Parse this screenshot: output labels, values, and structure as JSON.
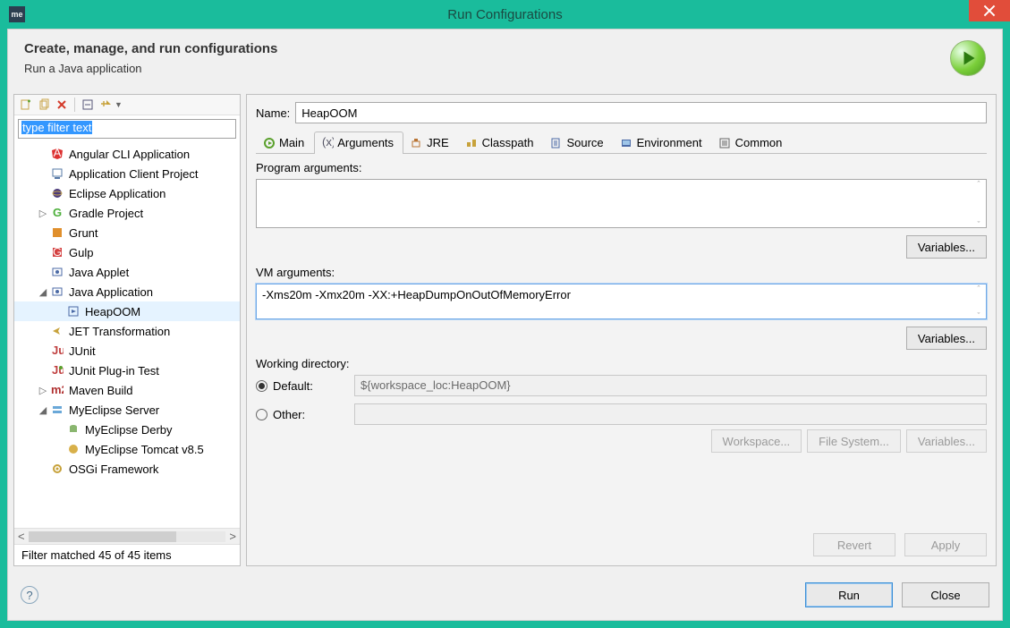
{
  "window": {
    "title": "Run Configurations",
    "close": "×"
  },
  "header": {
    "title": "Create, manage, and run configurations",
    "subtitle": "Run a Java application"
  },
  "filter": {
    "placeholder": "type filter text"
  },
  "tree": [
    {
      "label": "Angular CLI Application",
      "indent": 1,
      "expander": "",
      "icon": "angular"
    },
    {
      "label": "Application Client Project",
      "indent": 1,
      "expander": "",
      "icon": "appclient"
    },
    {
      "label": "Eclipse Application",
      "indent": 1,
      "expander": "",
      "icon": "eclipse"
    },
    {
      "label": "Gradle Project",
      "indent": 1,
      "expander": "▷",
      "icon": "gradle"
    },
    {
      "label": "Grunt",
      "indent": 1,
      "expander": "",
      "icon": "grunt"
    },
    {
      "label": "Gulp",
      "indent": 1,
      "expander": "",
      "icon": "gulp"
    },
    {
      "label": "Java Applet",
      "indent": 1,
      "expander": "",
      "icon": "java"
    },
    {
      "label": "Java Application",
      "indent": 1,
      "expander": "◢",
      "icon": "java"
    },
    {
      "label": "HeapOOM",
      "indent": 2,
      "expander": "",
      "icon": "javarun",
      "selected": true
    },
    {
      "label": "JET Transformation",
      "indent": 1,
      "expander": "",
      "icon": "jet"
    },
    {
      "label": "JUnit",
      "indent": 1,
      "expander": "",
      "icon": "junit"
    },
    {
      "label": "JUnit Plug-in Test",
      "indent": 1,
      "expander": "",
      "icon": "junitplug"
    },
    {
      "label": "Maven Build",
      "indent": 1,
      "expander": "▷",
      "icon": "maven"
    },
    {
      "label": "MyEclipse Server",
      "indent": 1,
      "expander": "◢",
      "icon": "server"
    },
    {
      "label": "MyEclipse Derby",
      "indent": 2,
      "expander": "",
      "icon": "derby"
    },
    {
      "label": "MyEclipse Tomcat v8.5",
      "indent": 2,
      "expander": "",
      "icon": "tomcat"
    },
    {
      "label": "OSGi Framework",
      "indent": 1,
      "expander": "",
      "icon": "osgi"
    }
  ],
  "filter_status": "Filter matched 45 of 45 items",
  "name_field": {
    "label": "Name:",
    "value": "HeapOOM"
  },
  "tabs": [
    {
      "label": "Main",
      "icon": "main"
    },
    {
      "label": "Arguments",
      "icon": "args",
      "active": true
    },
    {
      "label": "JRE",
      "icon": "jre"
    },
    {
      "label": "Classpath",
      "icon": "classpath"
    },
    {
      "label": "Source",
      "icon": "source"
    },
    {
      "label": "Environment",
      "icon": "env"
    },
    {
      "label": "Common",
      "icon": "common"
    }
  ],
  "arguments": {
    "program_label": "Program arguments:",
    "program_value": "",
    "vm_label": "VM arguments:",
    "vm_value": "-Xms20m -Xmx20m -XX:+HeapDumpOnOutOfMemoryError",
    "variables_button": "Variables..."
  },
  "workdir": {
    "label": "Working directory:",
    "default_label": "Default:",
    "default_value": "${workspace_loc:HeapOOM}",
    "other_label": "Other:",
    "workspace_btn": "Workspace...",
    "filesystem_btn": "File System...",
    "variables_btn": "Variables..."
  },
  "footer": {
    "revert": "Revert",
    "apply": "Apply"
  },
  "dialog": {
    "run": "Run",
    "close": "Close"
  }
}
